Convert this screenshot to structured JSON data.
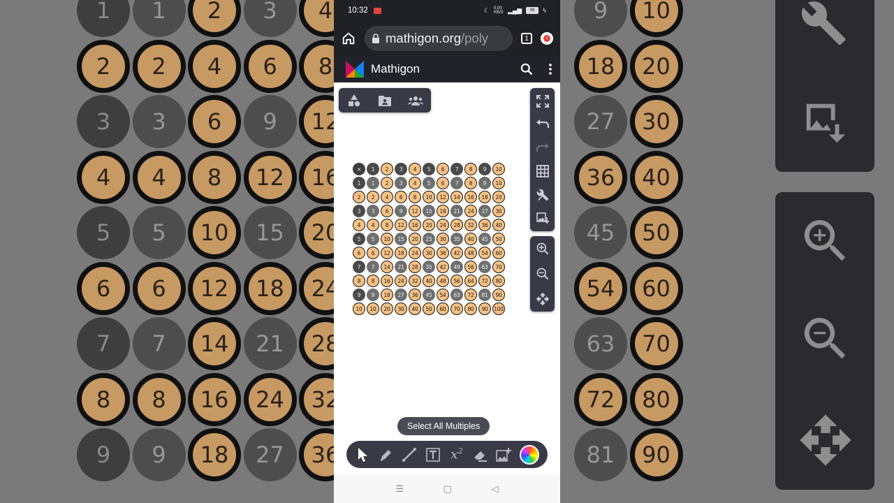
{
  "status_bar": {
    "time": "10:32",
    "net_speed": "0.00 KB/S",
    "battery": "96"
  },
  "browser": {
    "url_host": "mathigon.org",
    "url_path": "/poly",
    "tab_count": "1"
  },
  "app": {
    "title": "Mathigon"
  },
  "hint": {
    "label": "Select All Multiples"
  },
  "table": {
    "corner": "×",
    "size": 10,
    "highlight_multiple_of": 2
  },
  "colors": {
    "orange": "#f6c184",
    "dark": "#3a3a46",
    "app_bar": "#22232a"
  },
  "icons": {
    "top_toolbar": [
      "shapes-icon",
      "folder-account-icon",
      "group-icon"
    ],
    "right_toolbar": [
      "fullscreen-icon",
      "undo-icon",
      "redo-icon",
      "grid-icon",
      "tools-icon",
      "image-download-icon"
    ],
    "zoom_toolbar": [
      "zoom-in-icon",
      "zoom-out-icon",
      "pan-icon"
    ],
    "bottom_toolbar": [
      "cursor-icon",
      "pen-icon",
      "line-icon",
      "text-icon",
      "equation-icon",
      "eraser-icon",
      "add-image-icon",
      "color-picker-icon"
    ]
  }
}
